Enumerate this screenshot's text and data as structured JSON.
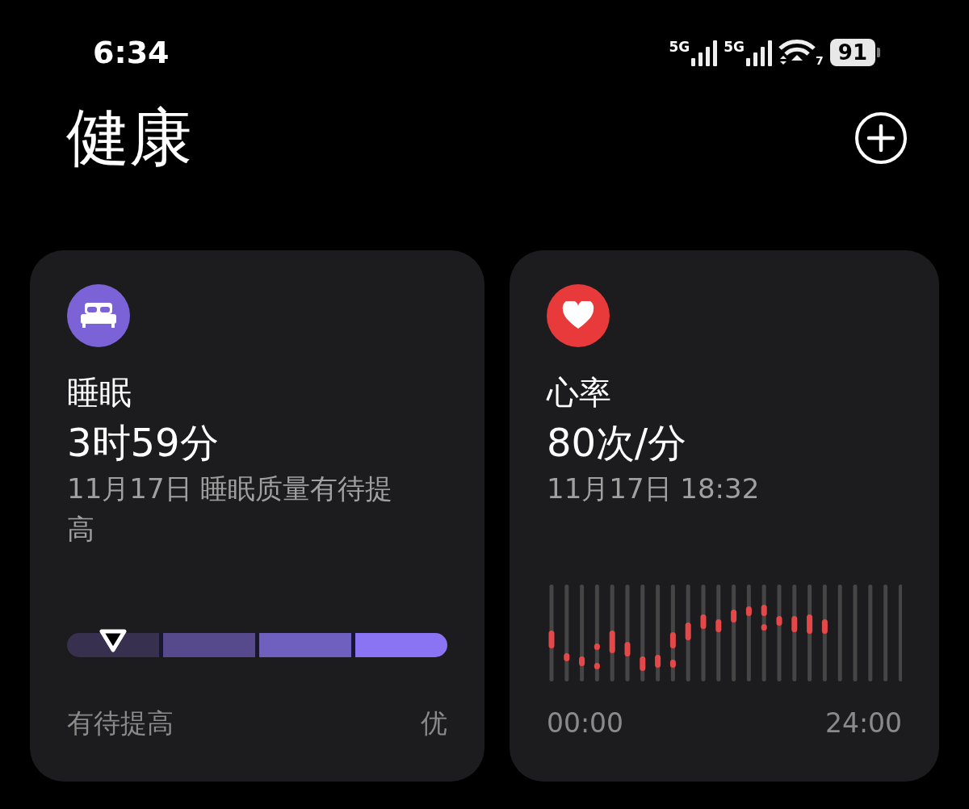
{
  "status_bar": {
    "time": "6:34",
    "network_1": "5G",
    "network_2": "5G",
    "wifi_band": "7",
    "battery": "91"
  },
  "header": {
    "title": "健康"
  },
  "cards": [
    {
      "kind": "sleep",
      "title": "睡眠",
      "value": "3时59分",
      "detail": "11月17日 睡眠质量有待提高",
      "scale": {
        "level": 0.12,
        "low_label": "有待提高",
        "high_label": "优"
      }
    },
    {
      "kind": "heart",
      "title": "心率",
      "value": "80次/分",
      "detail": "11月17日 18:32",
      "axis": {
        "start": "00:00",
        "end": "24:00"
      }
    }
  ]
}
